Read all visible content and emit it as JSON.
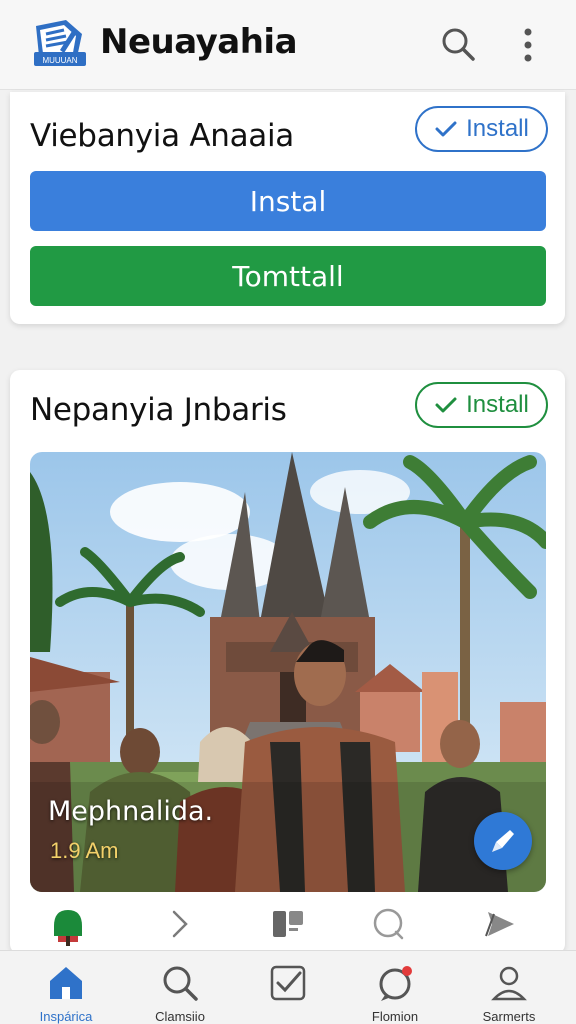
{
  "header": {
    "title": "Neuayahia",
    "logo_text": "MUUUAN",
    "logo_icon": "document-logo-icon",
    "search_icon": "search-icon",
    "menu_icon": "more-vert-icon"
  },
  "card1": {
    "title": "Viebanyia Anaaia",
    "pill_label": "Install",
    "primary_button": "Instal",
    "secondary_button": "Tomttall"
  },
  "card2": {
    "title": "Nepanyia Jnbaris",
    "pill_label": "Install",
    "photo": {
      "caption": "Mephnalida.",
      "time": "1.9 Am"
    },
    "action_icons": [
      "tree-icon",
      "chevron-right-icon",
      "list-icon",
      "chat-icon",
      "send-icon"
    ]
  },
  "bottom_nav": {
    "items": [
      {
        "label": "Inspárica",
        "icon": "home-icon",
        "active": true
      },
      {
        "label": "Clamsiio",
        "icon": "search-icon",
        "active": false
      },
      {
        "label": "",
        "icon": "checklist-icon",
        "active": false
      },
      {
        "label": "Flomion",
        "icon": "notification-chat-icon",
        "active": false
      },
      {
        "label": "Sarmerts",
        "icon": "person-icon",
        "active": false
      }
    ]
  },
  "colors": {
    "accent_blue": "#3a7fdc",
    "accent_green": "#219a44",
    "caption_time": "#f3d16a"
  }
}
